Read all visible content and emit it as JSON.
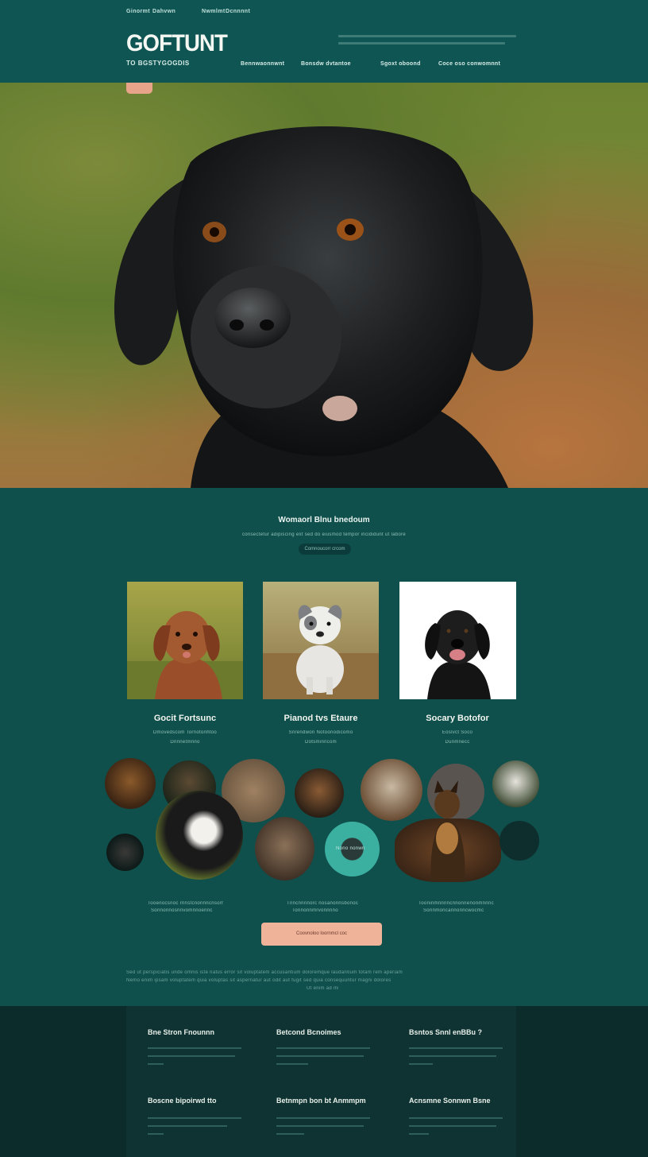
{
  "colors": {
    "header_bg": "#0f5553",
    "page_bg": "#0f4f4c",
    "accent_peach": "#efb39a",
    "footer_bg": "#0c2c2b"
  },
  "header": {
    "top_links": [
      "Ginormt",
      "Dahvwn",
      "Nwmlmt",
      "Dcnnnnt"
    ],
    "logo": "GOFTUNT",
    "tagline": "TO BGSTYGOGDIS",
    "nav": [
      "Bennwaonnwnt",
      "Bonsdw dvtantoe",
      "Sgoxt oboond",
      "Coce oso conwomnnt"
    ],
    "blurb": [
      "lorem ipsum text line",
      "lorem ipsum text line"
    ]
  },
  "hero": {
    "image": "black-dog-portrait"
  },
  "intro": {
    "title": "Womaorl Blnu bnedoum",
    "subtitle": "consectetur adipiscing elit sed do eiusmod tempor incididunt ut labore",
    "pill": "Comnoucorr crcom"
  },
  "cards": [
    {
      "image": "brown-dog-photo",
      "title": "Gocit Fortsunc",
      "line1": "Dmovedscom Tornotonhtoo",
      "line2": "Dnnnetmnno"
    },
    {
      "image": "grey-puppy-photo",
      "title": "Pianod tvs Etaure",
      "line1": "Snrendwon Notoonodicomo",
      "line2": "Dotsminncom"
    },
    {
      "image": "black-dog-photo",
      "title": "Socary Botofor",
      "line1": "Eoslvct Soco",
      "line2": "Dunmnecc"
    }
  ],
  "gallery": {
    "center_badge": "Nono nonwn"
  },
  "gallery_captions": [
    {
      "line1": "Tooenocsnoc rnnstcnonnncnsom",
      "line2": "Sonnonnosnnvomnnoennc"
    },
    {
      "line1": "Tnncnnnnorc nosanonnsbonoc",
      "line2": "Tonnonnmrvonnnno"
    },
    {
      "line1": "Tooninmnnnncnnonnenonmnnnc",
      "line2": "Sonnmoncannonncwocmc"
    }
  ],
  "cta": {
    "label": "Coovnoloo loornmcl coc"
  },
  "long_text": [
    "Sed ut perspiciatis unde omnis iste natus error sit voluptatem accusantium doloremque laudantium totam rem aperiam",
    "Nemo enim ipsam voluptatem quia voluptas sit aspernatur aut odit aut fugit sed quia consequuntur magni dolores",
    "Ut enim ad minima"
  ],
  "footer": {
    "columns": [
      {
        "title": "Bne Stron Fnounnn"
      },
      {
        "title": "Betcond Bcnoimes"
      },
      {
        "title": "Bsntos Snnl enBBu ?"
      },
      {
        "title": "Boscne bipoirwd tto"
      },
      {
        "title": "Betnmpn bon bt Anmmpm"
      },
      {
        "title": "Acnsmne Sonnwn Bsne"
      }
    ]
  }
}
